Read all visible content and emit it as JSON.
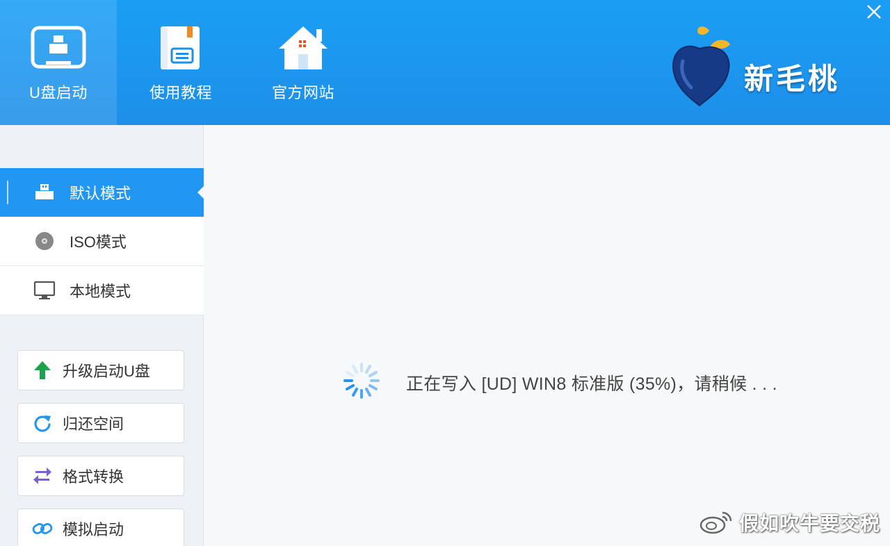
{
  "header": {
    "nav": [
      {
        "label": "U盘启动",
        "icon": "usb-boot-icon",
        "active": true
      },
      {
        "label": "使用教程",
        "icon": "tutorial-book-icon",
        "active": false
      },
      {
        "label": "官方网站",
        "icon": "home-icon",
        "active": false
      }
    ],
    "brand_name": "新毛桃",
    "close_icon": "close-icon"
  },
  "sidebar": {
    "modes": [
      {
        "label": "默认模式",
        "icon": "usb-drive-icon",
        "active": true
      },
      {
        "label": "ISO模式",
        "icon": "disc-icon",
        "active": false
      },
      {
        "label": "本地模式",
        "icon": "monitor-icon",
        "active": false
      }
    ],
    "tools": [
      {
        "label": "升级启动U盘",
        "icon": "upgrade-arrow-icon",
        "color": "#1aa34a"
      },
      {
        "label": "归还空间",
        "icon": "refresh-icon",
        "color": "#2196f3"
      },
      {
        "label": "格式转换",
        "icon": "swap-arrows-icon",
        "color": "#7b5fd6"
      },
      {
        "label": "模拟启动",
        "icon": "link-icon",
        "color": "#2196f3"
      }
    ]
  },
  "main": {
    "status_text": "正在写入 [UD] WIN8 标准版 (35%)，请稍候 . . .",
    "progress_percent": 35
  },
  "watermark": {
    "text": "假如吹牛要交税"
  },
  "colors": {
    "header_blue": "#1e8fe9",
    "accent_blue": "#2196f3"
  }
}
